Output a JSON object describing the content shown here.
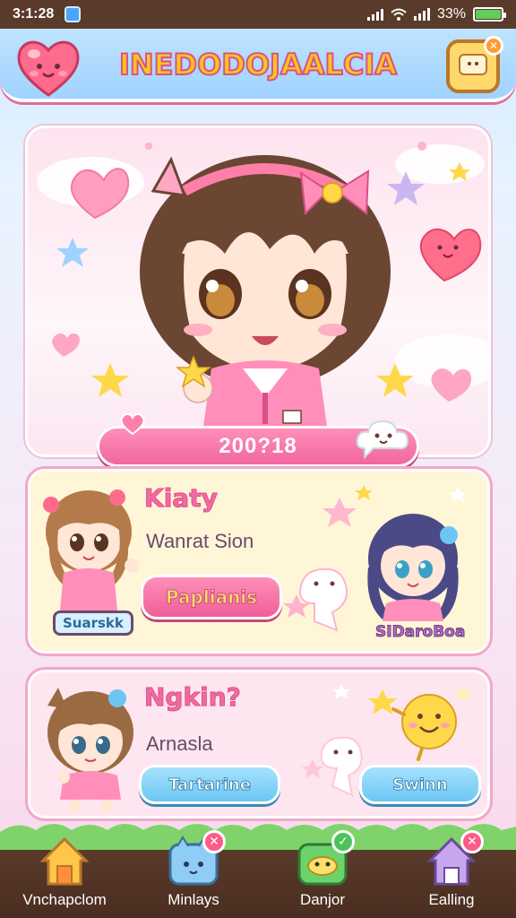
{
  "status_bar": {
    "time": "3:1:28",
    "battery_text": "33%"
  },
  "header": {
    "title": "INEDODOJAALCIA",
    "left_icon": "heart-icon",
    "right_icon": "chat-face-icon",
    "right_badge": "✕"
  },
  "hero": {
    "banner_text": "200?18"
  },
  "cards": [
    {
      "title": "Kiaty",
      "subtitle": "Wanrat Sion",
      "button_label": "Paplianis",
      "left_name_tag": "Suarskk",
      "right_name_tag": "SIDaroBoa"
    },
    {
      "title": "Ngkin?",
      "subtitle": "Arnasla",
      "button_left_label": "Tartarine",
      "button_right_label": "Swinn"
    }
  ],
  "bottom_nav": [
    {
      "label": "Vnchapclom",
      "icon": "home-icon",
      "badge": ""
    },
    {
      "label": "Minlays",
      "icon": "cat-tv-icon",
      "badge": "✕"
    },
    {
      "label": "Danjor",
      "icon": "frog-box-icon",
      "badge": "✓"
    },
    {
      "label": "Ealling",
      "icon": "house-purple-icon",
      "badge": "✕"
    }
  ],
  "colors": {
    "accent_pink": "#f06ba0",
    "accent_yellow": "#f6c81a",
    "sky_blue": "#9fd3ff",
    "nav_brown": "#4a2e21"
  }
}
